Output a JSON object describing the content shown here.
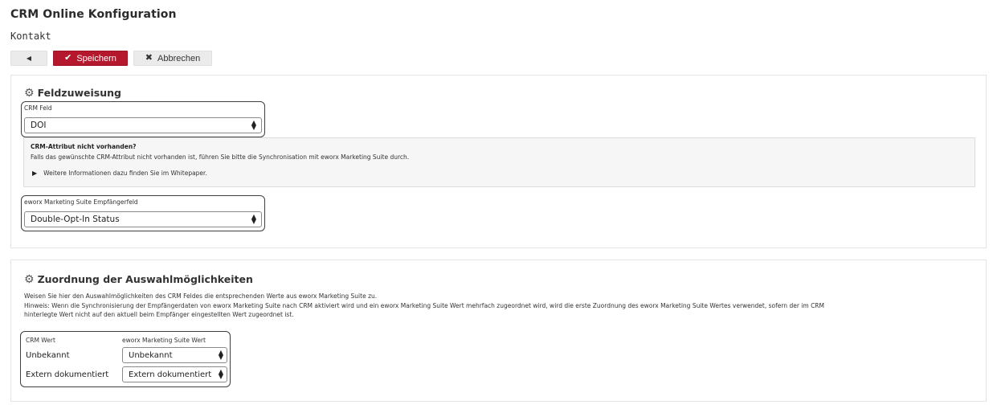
{
  "page": {
    "title": "CRM Online Konfiguration",
    "subtitle": "Kontakt"
  },
  "toolbar": {
    "back_icon": "caret-left-icon",
    "save_label": "Speichern",
    "save_icon": "check-icon",
    "cancel_label": "Abbrechen",
    "cancel_icon": "x-icon"
  },
  "colors": {
    "accent": "#b5182d"
  },
  "field_assignment": {
    "heading": "Feldzuweisung",
    "heading_icon": "gear-icon",
    "crm_field": {
      "label": "CRM Feld",
      "value": "DOI"
    },
    "info": {
      "title": "CRM-Attribut nicht vorhanden?",
      "text": "Falls das gewünschte CRM-Attribut nicht vorhanden ist, führen Sie bitte die Synchronisation mit eworx Marketing Suite durch.",
      "link": "Weitere Informationen dazu finden Sie im Whitepaper."
    },
    "recipient_field": {
      "label": "eworx Marketing Suite Empfängerfeld",
      "value": "Double-Opt-In Status"
    }
  },
  "option_mapping": {
    "heading": "Zuordnung der Auswahlmöglichkeiten",
    "heading_icon": "gear-icon",
    "desc_line1": "Weisen Sie hier den Auswahlmöglichkeiten des CRM Feldes die entsprechenden Werte aus eworx Marketing Suite zu.",
    "desc_line2": "Hinweis: Wenn die Synchronisierung der Empfängerdaten von eworx Marketing Suite nach CRM aktiviert wird und ein eworx Marketing Suite Wert mehrfach zugeordnet wird, wird die erste Zuordnung des eworx Marketing Suite Wertes verwendet, sofern der im CRM",
    "desc_line3": "hinterlegte Wert nicht auf den aktuell beim Empfänger eingestellten Wert zugeordnet ist.",
    "col_crm": "CRM Wert",
    "col_suite": "eworx Marketing Suite Wert",
    "rows": [
      {
        "crm": "Unbekannt",
        "suite": "Unbekannt"
      },
      {
        "crm": "Extern dokumentiert",
        "suite": "Extern dokumentiert"
      }
    ]
  }
}
